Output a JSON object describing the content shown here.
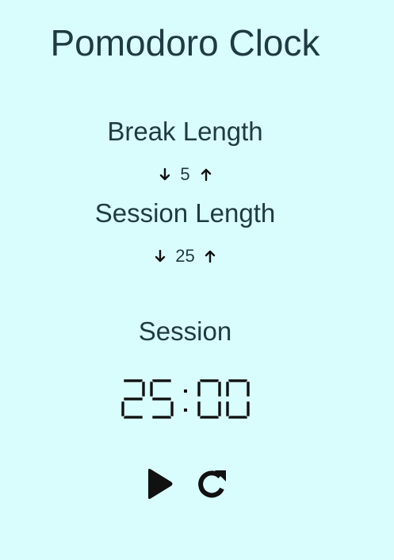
{
  "app": {
    "title": "Pomodoro Clock"
  },
  "break_control": {
    "label": "Break Length",
    "value": "5",
    "decrement_icon": "arrow-down",
    "increment_icon": "arrow-up"
  },
  "session_control": {
    "label": "Session Length",
    "value": "25",
    "decrement_icon": "arrow-down",
    "increment_icon": "arrow-up"
  },
  "timer": {
    "label": "Session",
    "time": "25:00"
  },
  "controls": {
    "play_icon": "play",
    "reset_icon": "refresh"
  },
  "colors": {
    "background": "#d9fdfd",
    "text": "#1f3b42",
    "icons": "#111111"
  }
}
